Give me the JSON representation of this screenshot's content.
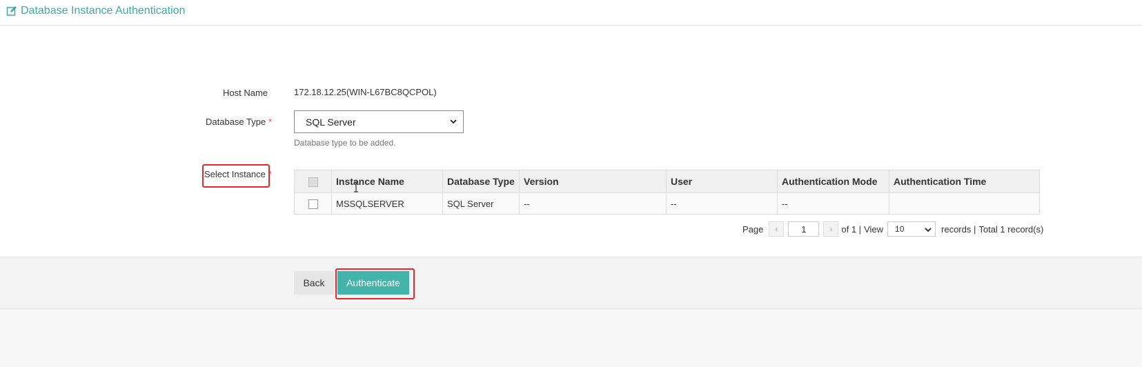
{
  "header": {
    "title": "Database Instance Authentication",
    "icon": "edit-icon"
  },
  "form": {
    "host_name_label": "Host Name",
    "host_name_value": "172.18.12.25(WIN-L67BC8QCPOL)",
    "database_type_label": "Database Type",
    "required_mark": "*",
    "database_type_value": "SQL Server",
    "database_type_hint": "Database type to be added.",
    "select_instance_label": "Select Instance"
  },
  "table": {
    "columns": [
      "Instance Name",
      "Database Type",
      "Version",
      "User",
      "Authentication Mode",
      "Authentication Time"
    ],
    "rows": [
      {
        "instance_name": "MSSQLSERVER",
        "database_type": "SQL Server",
        "version": "--",
        "user": "--",
        "auth_mode": "--",
        "auth_time": ""
      }
    ]
  },
  "pager": {
    "page_label": "Page",
    "prev": "‹",
    "current_page": "1",
    "next": "›",
    "of_label": "of 1 |",
    "view_label": "View",
    "page_size": "10",
    "records_label": "records |",
    "total_label": "Total 1 record(s)"
  },
  "actions": {
    "back": "Back",
    "authenticate": "Authenticate"
  },
  "colors": {
    "accent": "#44b3aa",
    "title": "#3ea9a5",
    "highlight": "#e8262b"
  }
}
